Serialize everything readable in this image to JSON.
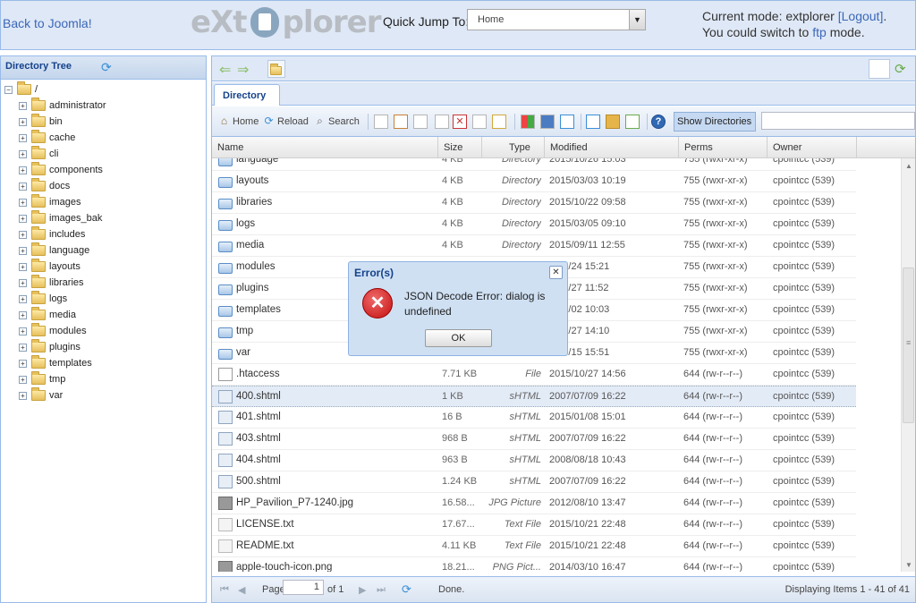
{
  "header": {
    "back_link": "Back to Joomla!",
    "logo": {
      "left": "eXt",
      "right": "plorer"
    },
    "quick_jump_label": "Quick Jump To:",
    "quick_jump_value": "Home",
    "mode": {
      "prefix": "Current mode: extplorer ",
      "logout": "[Logout]",
      "middle": ". You could switch to ",
      "ftp": "ftp",
      "suffix": " mode."
    }
  },
  "tree": {
    "title": "Directory Tree",
    "root": "/",
    "items": [
      "administrator",
      "bin",
      "cache",
      "cli",
      "components",
      "docs",
      "images",
      "images_bak",
      "includes",
      "language",
      "layouts",
      "libraries",
      "logs",
      "media",
      "modules",
      "plugins",
      "templates",
      "tmp",
      "var"
    ]
  },
  "tab": "Directory",
  "toolbar": {
    "home": "Home",
    "reload": "Reload",
    "search": "Search",
    "show_directories": "Show Directories"
  },
  "columns": {
    "name": "Name",
    "size": "Size",
    "type": "Type",
    "modified": "Modified",
    "perms": "Perms",
    "owner": "Owner"
  },
  "rows": [
    {
      "name": "language",
      "size": "4 KB",
      "type": "Directory",
      "modified": "2015/10/26 15:03",
      "perms": "755 (rwxr-xr-x)",
      "owner": "cpointcc (539)",
      "icon": "folder-icon"
    },
    {
      "name": "layouts",
      "size": "4 KB",
      "type": "Directory",
      "modified": "2015/03/03 10:19",
      "perms": "755 (rwxr-xr-x)",
      "owner": "cpointcc (539)",
      "icon": "folder-icon"
    },
    {
      "name": "libraries",
      "size": "4 KB",
      "type": "Directory",
      "modified": "2015/10/22 09:58",
      "perms": "755 (rwxr-xr-x)",
      "owner": "cpointcc (539)",
      "icon": "folder-icon"
    },
    {
      "name": "logs",
      "size": "4 KB",
      "type": "Directory",
      "modified": "2015/03/05 09:10",
      "perms": "755 (rwxr-xr-x)",
      "owner": "cpointcc (539)",
      "icon": "folder-icon"
    },
    {
      "name": "media",
      "size": "4 KB",
      "type": "Directory",
      "modified": "2015/09/11 12:55",
      "perms": "755 (rwxr-xr-x)",
      "owner": "cpointcc (539)",
      "icon": "folder-icon"
    },
    {
      "name": "modules",
      "size": "",
      "type": "",
      "modified": "5/09/24 15:21",
      "perms": "755 (rwxr-xr-x)",
      "owner": "cpointcc (539)",
      "icon": "folder-icon"
    },
    {
      "name": "plugins",
      "size": "",
      "type": "",
      "modified": "5/04/27 11:52",
      "perms": "755 (rwxr-xr-x)",
      "owner": "cpointcc (539)",
      "icon": "folder-icon"
    },
    {
      "name": "templates",
      "size": "",
      "type": "",
      "modified": "5/07/02 10:03",
      "perms": "755 (rwxr-xr-x)",
      "owner": "cpointcc (539)",
      "icon": "folder-icon"
    },
    {
      "name": "tmp",
      "size": "",
      "type": "",
      "modified": "5/10/27 14:10",
      "perms": "755 (rwxr-xr-x)",
      "owner": "cpointcc (539)",
      "icon": "folder-icon"
    },
    {
      "name": "var",
      "size": "",
      "type": "",
      "modified": "4/08/15 15:51",
      "perms": "755 (rwxr-xr-x)",
      "owner": "cpointcc (539)",
      "icon": "folder-icon"
    },
    {
      "name": ".htaccess",
      "size": "7.71 KB",
      "type": "File",
      "modified": "2015/10/27 14:56",
      "perms": "644 (rw-r--r--)",
      "owner": "cpointcc (539)",
      "icon": "file-icon"
    },
    {
      "name": "400.shtml",
      "size": "1 KB",
      "type": "sHTML",
      "modified": "2007/07/09 16:22",
      "perms": "644 (rw-r--r--)",
      "owner": "cpointcc (539)",
      "icon": "html-file-icon",
      "selected": true
    },
    {
      "name": "401.shtml",
      "size": "16 B",
      "type": "sHTML",
      "modified": "2015/01/08 15:01",
      "perms": "644 (rw-r--r--)",
      "owner": "cpointcc (539)",
      "icon": "html-file-icon"
    },
    {
      "name": "403.shtml",
      "size": "968 B",
      "type": "sHTML",
      "modified": "2007/07/09 16:22",
      "perms": "644 (rw-r--r--)",
      "owner": "cpointcc (539)",
      "icon": "html-file-icon"
    },
    {
      "name": "404.shtml",
      "size": "963 B",
      "type": "sHTML",
      "modified": "2008/08/18 10:43",
      "perms": "644 (rw-r--r--)",
      "owner": "cpointcc (539)",
      "icon": "html-file-icon"
    },
    {
      "name": "500.shtml",
      "size": "1.24 KB",
      "type": "sHTML",
      "modified": "2007/07/09 16:22",
      "perms": "644 (rw-r--r--)",
      "owner": "cpointcc (539)",
      "icon": "html-file-icon"
    },
    {
      "name": "HP_Pavilion_P7-1240.jpg",
      "size": "16.58...",
      "type": "JPG Picture",
      "modified": "2012/08/10 13:47",
      "perms": "644 (rw-r--r--)",
      "owner": "cpointcc (539)",
      "icon": "image-file-icon"
    },
    {
      "name": "LICENSE.txt",
      "size": "17.67...",
      "type": "Text File",
      "modified": "2015/10/21 22:48",
      "perms": "644 (rw-r--r--)",
      "owner": "cpointcc (539)",
      "icon": "text-file-icon"
    },
    {
      "name": "README.txt",
      "size": "4.11 KB",
      "type": "Text File",
      "modified": "2015/10/21 22:48",
      "perms": "644 (rw-r--r--)",
      "owner": "cpointcc (539)",
      "icon": "text-file-icon"
    },
    {
      "name": "apple-touch-icon.png",
      "size": "18.21...",
      "type": "PNG Pict...",
      "modified": "2014/03/10 16:47",
      "perms": "644 (rw-r--r--)",
      "owner": "cpointcc (539)",
      "icon": "image-file-icon"
    }
  ],
  "pager": {
    "page_label": "Page",
    "page": "1",
    "of": "of 1",
    "status": "Done.",
    "display": "Displaying Items 1 - 41 of 41"
  },
  "dialog": {
    "title": "Error(s)",
    "message": "JSON Decode Error: dialog is undefined",
    "ok": "OK"
  }
}
